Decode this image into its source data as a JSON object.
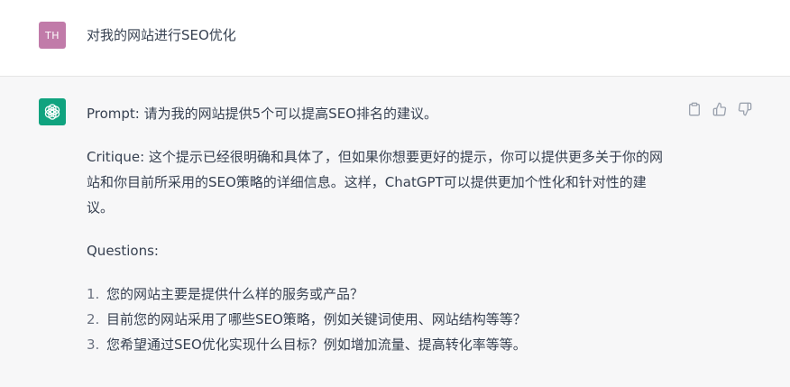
{
  "user": {
    "avatar_initials": "TH",
    "avatar_color": "#c17ba9",
    "message": "对我的网站进行SEO优化"
  },
  "assistant": {
    "avatar_icon": "openai-logo-icon",
    "avatar_color": "#10a37f",
    "prompt": "Prompt: 请为我的网站提供5个可以提高SEO排名的建议。",
    "critique": "Critique: 这个提示已经很明确和具体了，但如果你想要更好的提示，你可以提供更多关于你的网站和你目前所采用的SEO策略的详细信息。这样，ChatGPT可以提供更加个性化和针对性的建议。",
    "questions_label": "Questions:",
    "questions": [
      {
        "num": "1.",
        "text": "您的网站主要是提供什么样的服务或产品？"
      },
      {
        "num": "2.",
        "text": "目前您的网站采用了哪些SEO策略，例如关键词使用、网站结构等等？"
      },
      {
        "num": "3.",
        "text": "您希望通过SEO优化实现什么目标？例如增加流量、提高转化率等等。"
      }
    ]
  },
  "actions": {
    "icons": [
      "clipboard-icon",
      "thumbs-up-icon",
      "thumbs-down-icon"
    ]
  }
}
